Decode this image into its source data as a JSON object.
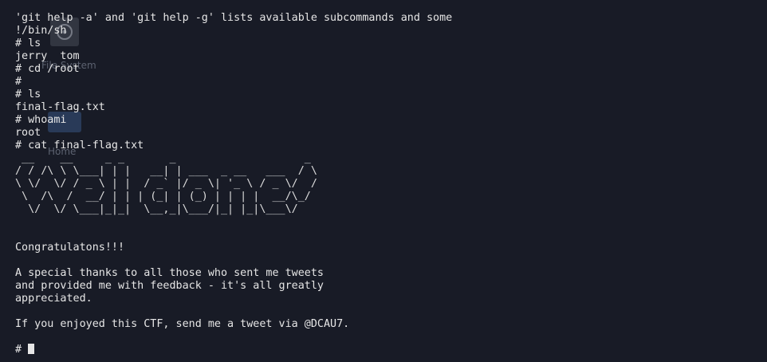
{
  "terminal": {
    "lines": [
      "'git help -a' and 'git help -g' lists available subcommands and some",
      "!/bin/sh",
      "# ls",
      "jerry  tom",
      "# cd /root",
      "#",
      "# ls",
      "final-flag.txt",
      "# whoami",
      "root",
      "# cat final-flag.txt"
    ],
    "banner": " __    __     _ _       _                    _ \n/ / /\\ \\ \\___| | |   __| | ___  _ __   ___  / \\\n\\ \\/  \\/ / _ \\ | |  / _` |/ _ \\| '_ \\ / _ \\/  /\n \\  /\\  /  __/ | | | (_| | (_) | | | |  __/\\_/\n  \\/  \\/ \\___|_|_|  \\__,_|\\___/|_| |_|\\___\\/   ",
    "message_lines": [
      "",
      "",
      "Congratulatons!!!",
      "",
      "A special thanks to all those who sent me tweets",
      "and provided me with feedback - it's all greatly",
      "appreciated.",
      "",
      "If you enjoyed this CTF, send me a tweet via @DCAU7.",
      ""
    ],
    "prompt": "# "
  },
  "desktop_ghosts": {
    "file_system_label": "File System",
    "home_label": "Home",
    "file_system_icon": "disk-icon",
    "home_icon": "home-folder-icon"
  },
  "colors": {
    "background": "#181b26",
    "foreground": "#e6e6e6"
  }
}
